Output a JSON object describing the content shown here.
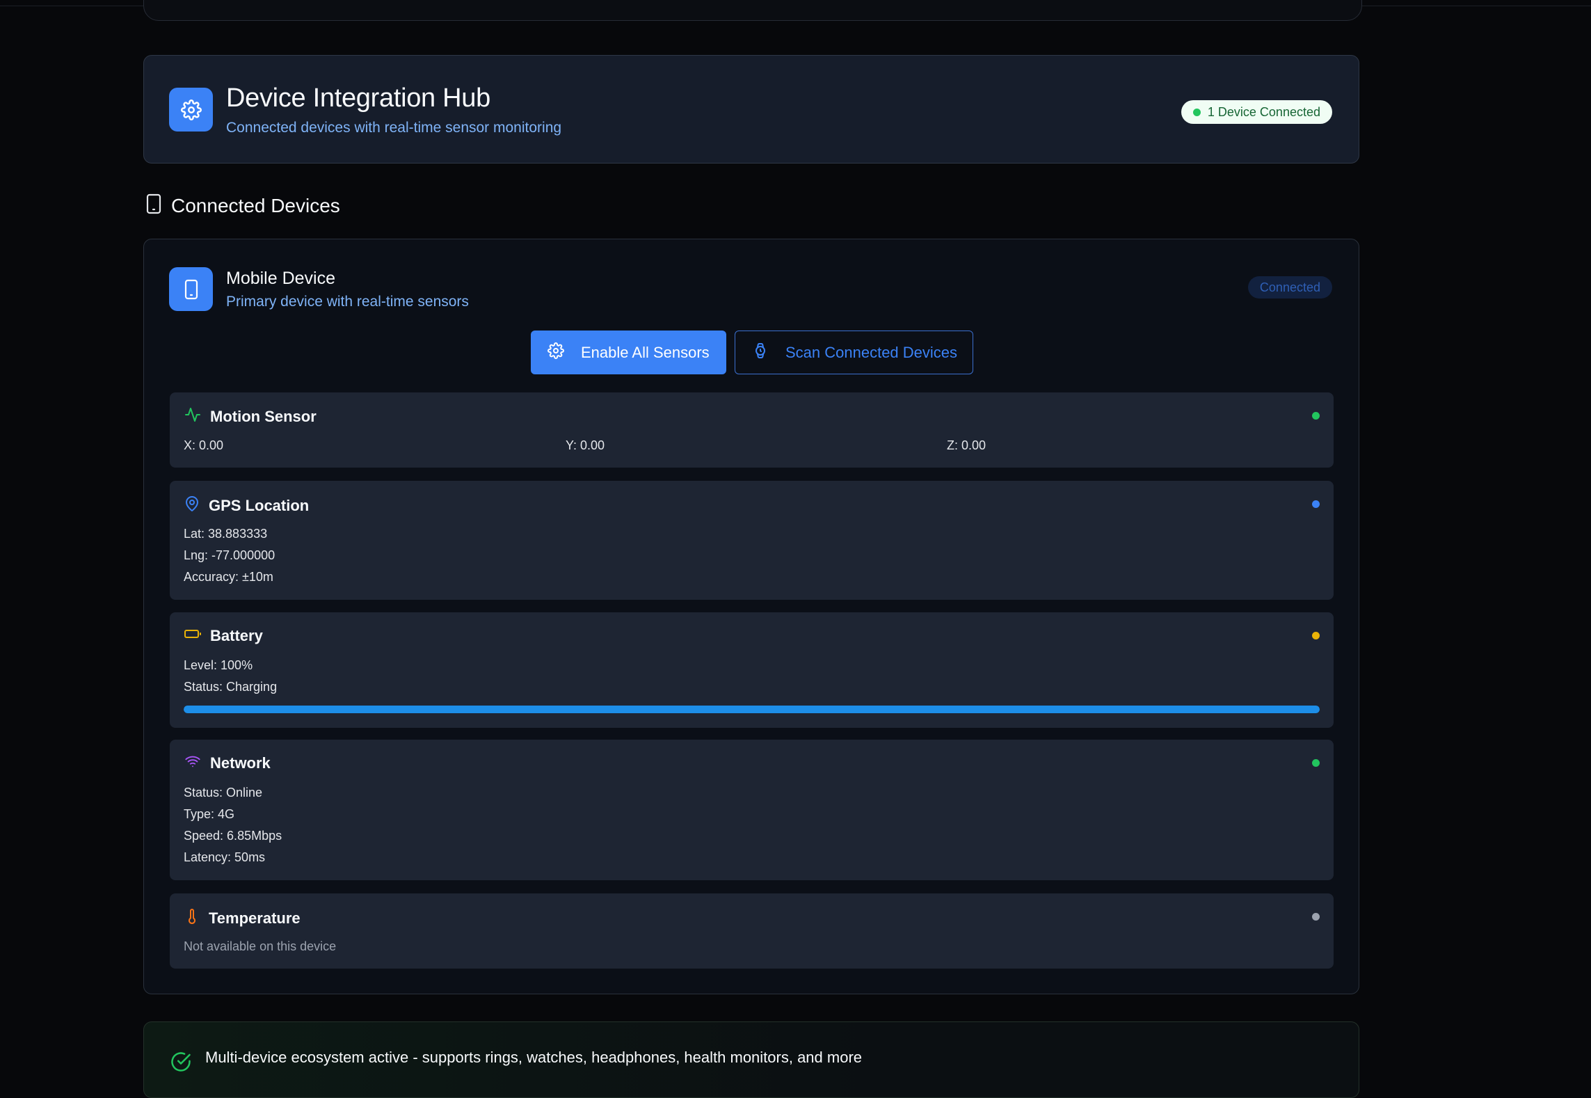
{
  "hub": {
    "title": "Device Integration Hub",
    "subtitle": "Connected devices with real-time sensor monitoring",
    "badge": "1 Device Connected",
    "icon": "gear-icon"
  },
  "section": {
    "title": "Connected Devices",
    "icon": "smartphone-icon"
  },
  "device": {
    "title": "Mobile Device",
    "subtitle": "Primary device with real-time sensors",
    "status": "Connected",
    "icon": "smartphone-icon",
    "buttons": {
      "enable_label": "Enable All Sensors",
      "scan_label": "Scan Connected Devices"
    }
  },
  "sensors": {
    "motion": {
      "title": "Motion Sensor",
      "x": "X: 0.00",
      "y": "Y: 0.00",
      "z": "Z: 0.00",
      "status_color": "#22c55e",
      "icon": "activity-icon"
    },
    "gps": {
      "title": "GPS Location",
      "lat": "Lat: 38.883333",
      "lng": "Lng: -77.000000",
      "accuracy": "Accuracy: ±10m",
      "status_color": "#3b82f6",
      "icon": "map-pin-icon"
    },
    "battery": {
      "title": "Battery",
      "level": "Level: 100%",
      "status": "Status: Charging",
      "level_fraction": 1.0,
      "status_color": "#eab308",
      "icon": "battery-icon"
    },
    "network": {
      "title": "Network",
      "status": "Status: Online",
      "type": "Type: 4G",
      "speed": "Speed: 6.85Mbps",
      "latency": "Latency: 50ms",
      "status_color": "#22c55e",
      "icon": "wifi-icon"
    },
    "temperature": {
      "title": "Temperature",
      "message": "Not available on this device",
      "status_color": "#9ca3af",
      "icon": "thermometer-icon"
    }
  },
  "footer": {
    "text": "Multi-device ecosystem active - supports rings, watches, headphones, health monitors, and more",
    "icon": "check-circle-icon"
  },
  "colors": {
    "accent": "#3b82f6",
    "background": "#07080b",
    "card": "#1e2533"
  }
}
